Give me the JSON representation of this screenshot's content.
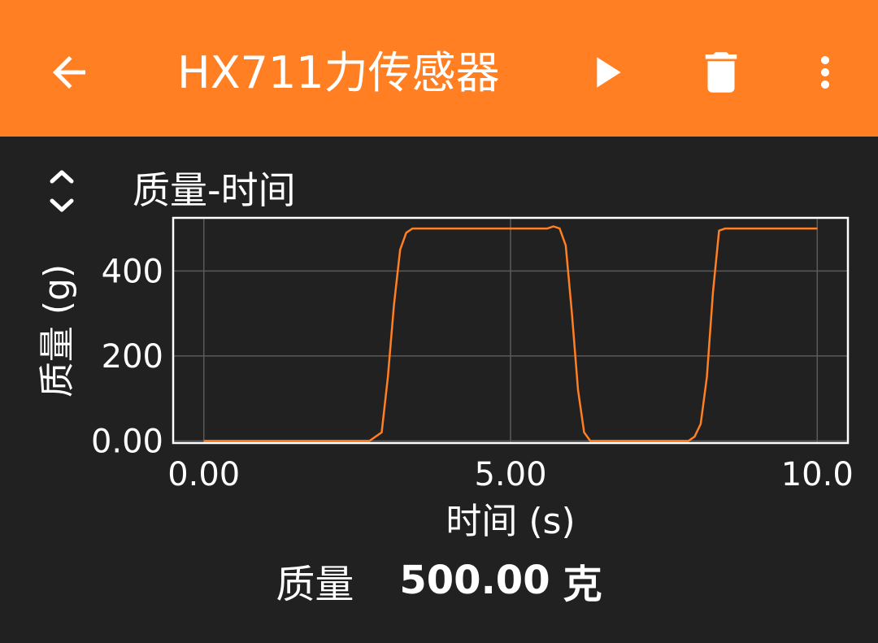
{
  "appbar": {
    "title": "HX711力传感器",
    "icons": {
      "back": "arrow-back-icon",
      "play": "play-icon",
      "delete": "trash-icon",
      "more": "more-vert-icon"
    },
    "color": "#FF7F22"
  },
  "graph": {
    "title": "质量-时间",
    "toggle_icon": "unfold-icon"
  },
  "chart_data": {
    "type": "line",
    "title": "",
    "xlabel": "时间 (s)",
    "ylabel": "质量 (g)",
    "xlim": [
      -0.5,
      10.5
    ],
    "ylim": [
      -5,
      525
    ],
    "x_ticks": [
      0,
      5,
      10
    ],
    "x_tick_labels": [
      "0.00",
      "5.00",
      "10.0"
    ],
    "y_ticks": [
      0,
      200,
      400
    ],
    "y_tick_labels": [
      "0.00",
      "200",
      "400"
    ],
    "grid": true,
    "line_color": "#FF7F22",
    "series": [
      {
        "x": [
          0,
          2.7,
          2.9,
          3.0,
          3.1,
          3.2,
          3.3,
          3.4,
          3.5,
          5.6,
          5.7,
          5.8,
          5.9,
          6.0,
          6.1,
          6.2,
          6.3,
          6.4,
          7.9,
          8.0,
          8.1,
          8.2,
          8.3,
          8.4,
          8.5,
          10.0
        ],
        "y": [
          0,
          0,
          20,
          150,
          320,
          450,
          490,
          500,
          500,
          500,
          505,
          500,
          460,
          300,
          120,
          20,
          0,
          0,
          0,
          10,
          40,
          150,
          350,
          495,
          500,
          500
        ]
      }
    ]
  },
  "readout": {
    "label": "质量",
    "value": "500.00",
    "unit": "克"
  }
}
